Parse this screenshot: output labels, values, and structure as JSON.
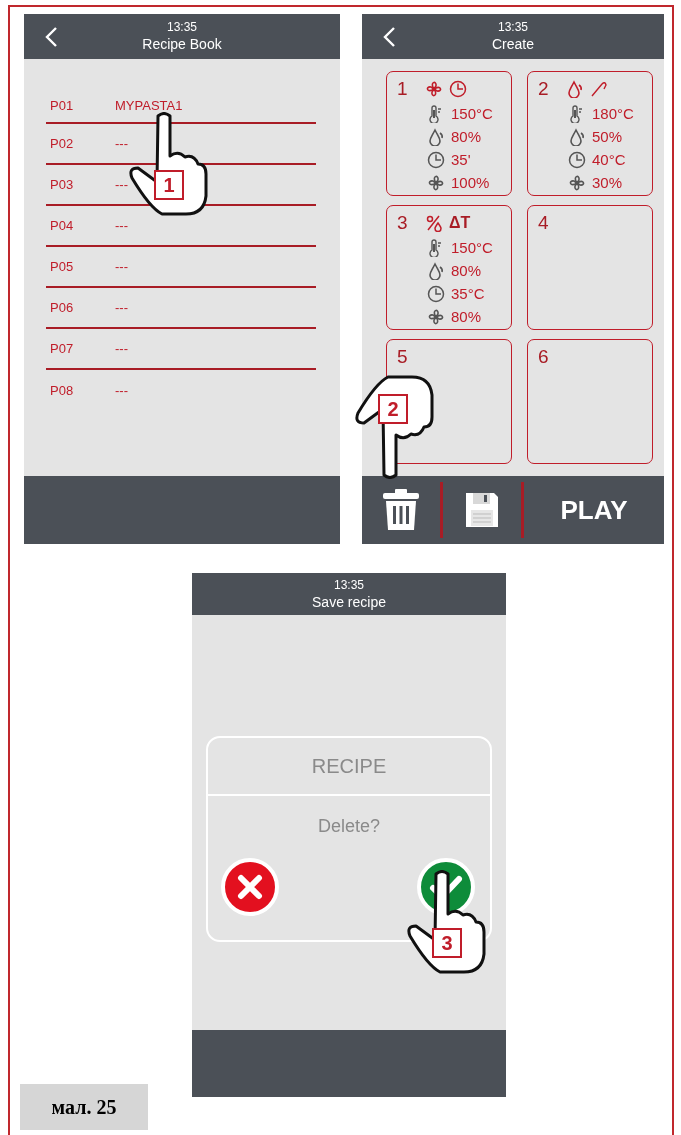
{
  "recipe_book_screen": {
    "header": {
      "time": "13:35",
      "title": "Recipe Book"
    },
    "rows": [
      {
        "slot": "P01",
        "name": "MYPASTA1"
      },
      {
        "slot": "P02",
        "name": "---"
      },
      {
        "slot": "P03",
        "name": "---"
      },
      {
        "slot": "P04",
        "name": "---"
      },
      {
        "slot": "P05",
        "name": "---"
      },
      {
        "slot": "P06",
        "name": "---"
      },
      {
        "slot": "P07",
        "name": "---"
      },
      {
        "slot": "P08",
        "name": "---"
      }
    ],
    "step_marker": "1"
  },
  "create_screen": {
    "header": {
      "time": "13:35",
      "title": "Create"
    },
    "cards": [
      {
        "number": "1",
        "modes": [
          {
            "kind": "fan"
          },
          {
            "kind": "clock"
          }
        ],
        "params": [
          {
            "kind": "thermometer",
            "value": "150°C"
          },
          {
            "kind": "droplet",
            "value": "80%"
          },
          {
            "kind": "clock",
            "value": "35'"
          },
          {
            "kind": "fan",
            "value": "100%"
          }
        ]
      },
      {
        "number": "2",
        "modes": [
          {
            "kind": "droplet"
          },
          {
            "kind": "probe"
          }
        ],
        "params": [
          {
            "kind": "thermometer",
            "value": "180°C"
          },
          {
            "kind": "droplet",
            "value": "50%"
          },
          {
            "kind": "clock",
            "value": "40°C"
          },
          {
            "kind": "fan",
            "value": "30%"
          }
        ]
      },
      {
        "number": "3",
        "modes": [
          {
            "kind": "humidity-percent"
          },
          {
            "kind": "label",
            "text": "ΔT"
          }
        ],
        "params": [
          {
            "kind": "thermometer",
            "value": "150°C"
          },
          {
            "kind": "droplet",
            "value": "80%"
          },
          {
            "kind": "clock",
            "value": "35°C"
          },
          {
            "kind": "fan",
            "value": "80%"
          }
        ]
      },
      {
        "number": "4"
      },
      {
        "number": "5"
      },
      {
        "number": "6"
      }
    ],
    "play_button": "PLAY",
    "step_marker": "2"
  },
  "delete_screen": {
    "header": {
      "time": "13:35",
      "title": "Save recipe"
    },
    "dialog": {
      "title": "RECIPE",
      "message": "Delete?"
    },
    "step_marker": "3"
  },
  "caption": "мал. 25"
}
